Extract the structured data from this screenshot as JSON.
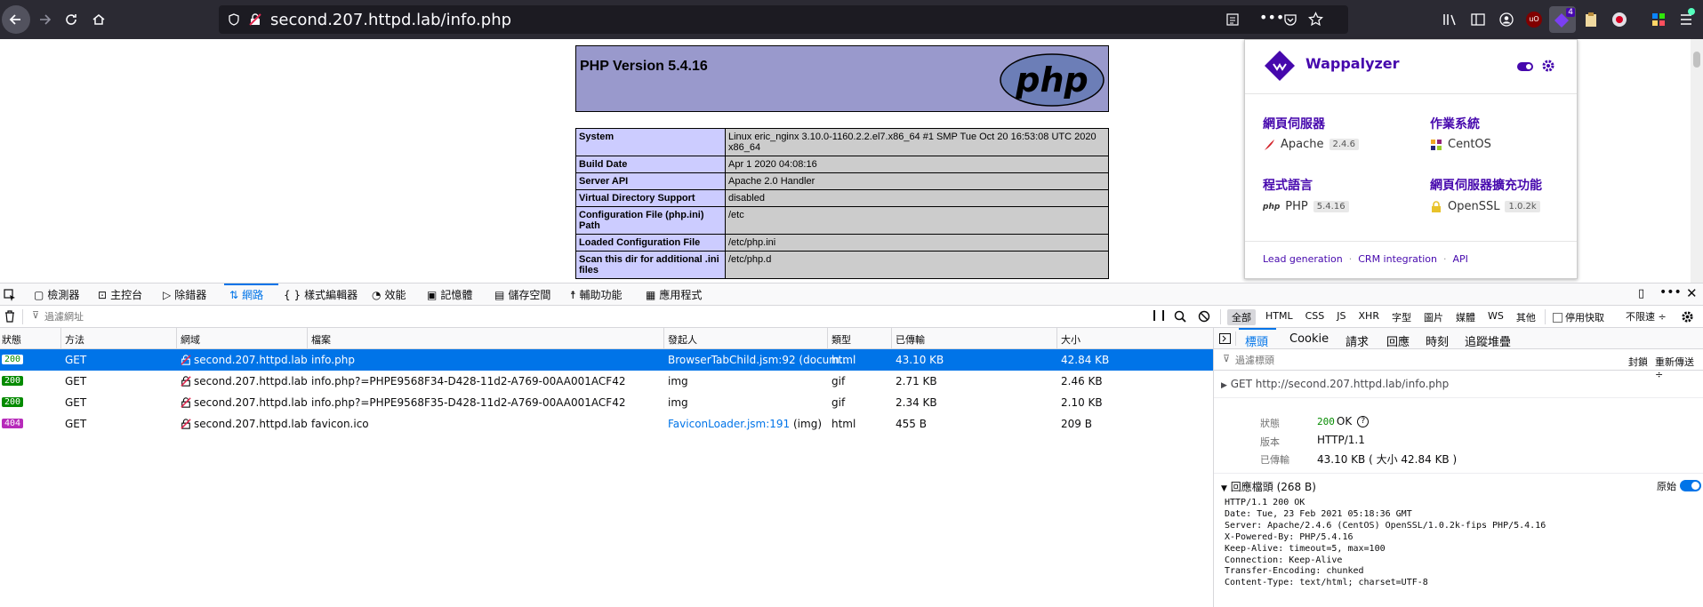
{
  "browser": {
    "url": "second.207.httpd.lab/info.php",
    "wappalyzer_badge": "4"
  },
  "phpinfo": {
    "title": "PHP Version 5.4.16",
    "logo_text": "php",
    "rows": [
      {
        "key": "System",
        "value": "Linux eric_nginx 3.10.0-1160.2.2.el7.x86_64 #1 SMP Tue Oct 20 16:53:08 UTC 2020 x86_64"
      },
      {
        "key": "Build Date",
        "value": "Apr 1 2020 04:08:16"
      },
      {
        "key": "Server API",
        "value": "Apache 2.0 Handler"
      },
      {
        "key": "Virtual Directory Support",
        "value": "disabled"
      },
      {
        "key": "Configuration File (php.ini) Path",
        "value": "/etc"
      },
      {
        "key": "Loaded Configuration File",
        "value": "/etc/php.ini"
      },
      {
        "key": "Scan this dir for additional .ini files",
        "value": "/etc/php.d"
      }
    ]
  },
  "wappalyzer": {
    "title": "Wappalyzer",
    "categories": [
      {
        "name": "網頁伺服器",
        "tech": "Apache",
        "version": "2.4.6"
      },
      {
        "name": "作業系統",
        "tech": "CentOS",
        "version": ""
      },
      {
        "name": "程式語言",
        "tech": "PHP",
        "version": "5.4.16"
      },
      {
        "name": "網頁伺服器擴充功能",
        "tech": "OpenSSL",
        "version": "1.0.2k"
      }
    ],
    "links": [
      "Lead generation",
      "CRM integration",
      "API"
    ],
    "separator": "·"
  },
  "devtools": {
    "tabs": [
      "檢測器",
      "主控台",
      "除錯器",
      "網路",
      "樣式編輯器",
      "效能",
      "記憶體",
      "儲存空間",
      "輔助功能",
      "應用程式"
    ],
    "filter_placeholder": "過濾網址",
    "type_filters": [
      "全部",
      "HTML",
      "CSS",
      "JS",
      "XHR",
      "字型",
      "圖片",
      "媒體",
      "WS",
      "其他"
    ],
    "disable_cache": "停用快取",
    "throttle": "不限速 ÷",
    "columns": [
      "狀態",
      "方法",
      "網域",
      "檔案",
      "發起人",
      "類型",
      "已傳輸",
      "大小"
    ],
    "requests": [
      {
        "status": "200",
        "method": "GET",
        "domain": "second.207.httpd.lab",
        "file": "info.php",
        "initiator": "BrowserTabChild.jsm:92 (docum...",
        "type": "html",
        "transferred": "43.10 KB",
        "size": "42.84 KB"
      },
      {
        "status": "200",
        "method": "GET",
        "domain": "second.207.httpd.lab",
        "file": "info.php?=PHPE9568F34-D428-11d2-A769-00AA001ACF42",
        "initiator": "img",
        "type": "gif",
        "transferred": "2.71 KB",
        "size": "2.46 KB"
      },
      {
        "status": "200",
        "method": "GET",
        "domain": "second.207.httpd.lab",
        "file": "info.php?=PHPE9568F35-D428-11d2-A769-00AA001ACF42",
        "initiator": "img",
        "type": "gif",
        "transferred": "2.34 KB",
        "size": "2.10 KB"
      },
      {
        "status": "404",
        "method": "GET",
        "domain": "second.207.httpd.lab",
        "file": "favicon.ico",
        "initiator_link": "FaviconLoader.jsm:191",
        "initiator_suffix": " (img)",
        "type": "html",
        "transferred": "455 B",
        "size": "209 B"
      }
    ],
    "side_tabs": [
      "標頭",
      "Cookie",
      "請求",
      "回應",
      "時刻",
      "追蹤堆疊"
    ],
    "side_filter_placeholder": "過濾標頭",
    "block": "封鎖",
    "resend": "重新傳送 ÷",
    "request_line": "GET http://second.207.httpd.lab/info.php",
    "summary": [
      {
        "label": "狀態",
        "status": "200",
        "value": "OK"
      },
      {
        "label": "版本",
        "value": "HTTP/1.1"
      },
      {
        "label": "已傳輸",
        "value": "43.10 KB ( 大小 42.84 KB )"
      }
    ],
    "response_headers_title": "回應檔頭 (268 B)",
    "raw_label": "原始",
    "raw_headers": [
      "HTTP/1.1 200 OK",
      "Date: Tue, 23 Feb 2021 05:18:36 GMT",
      "Server: Apache/2.4.6 (CentOS) OpenSSL/1.0.2k-fips PHP/5.4.16",
      "X-Powered-By: PHP/5.4.16",
      "Keep-Alive: timeout=5, max=100",
      "Connection: Keep-Alive",
      "Transfer-Encoding: chunked",
      "Content-Type: text/html; charset=UTF-8"
    ]
  },
  "colors": {
    "accent": "#0074e8",
    "wappalyzer": "#4608ad",
    "ok": "#12bc00",
    "notfound": "#d70022"
  }
}
